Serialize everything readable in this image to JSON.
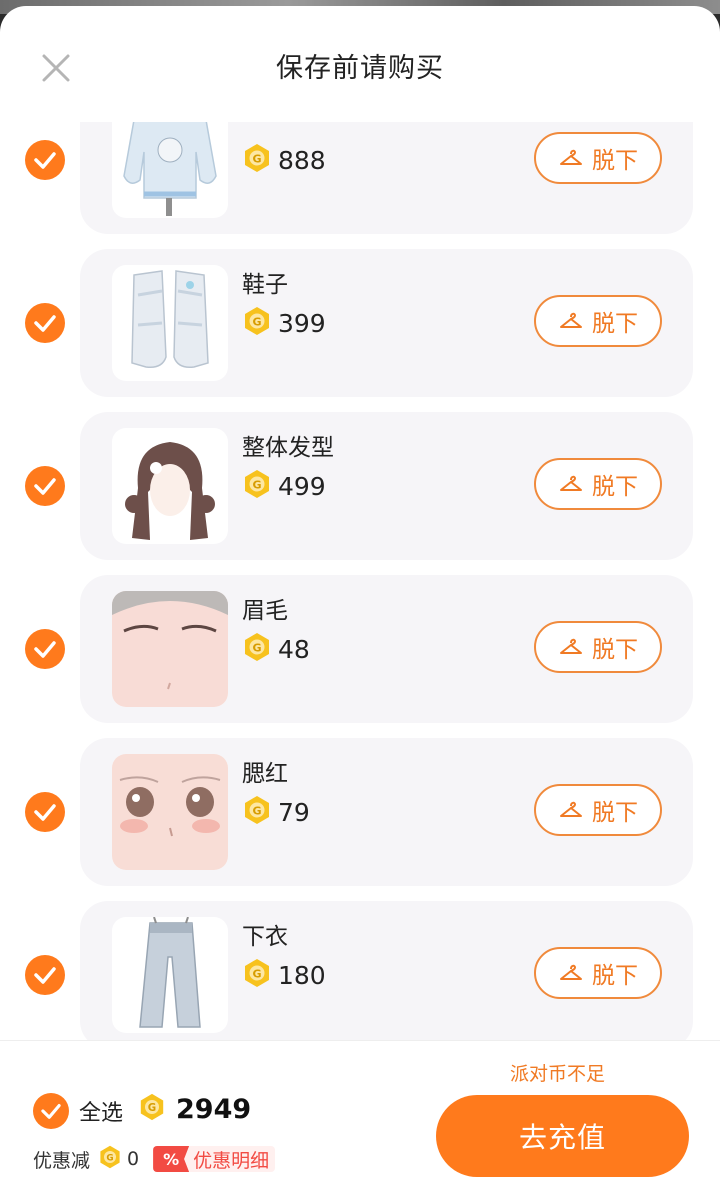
{
  "dialog": {
    "title": "保存前请购买"
  },
  "items": [
    {
      "name": "",
      "price": "888",
      "remove_label": "脱下",
      "thumb": "hoodie"
    },
    {
      "name": "鞋子",
      "price": "399",
      "remove_label": "脱下",
      "thumb": "shoes"
    },
    {
      "name": "整体发型",
      "price": "499",
      "remove_label": "脱下",
      "thumb": "hair"
    },
    {
      "name": "眉毛",
      "price": "48",
      "remove_label": "脱下",
      "thumb": "eyebrows"
    },
    {
      "name": "腮红",
      "price": "79",
      "remove_label": "脱下",
      "thumb": "blush"
    },
    {
      "name": "下衣",
      "price": "180",
      "remove_label": "脱下",
      "thumb": "pants"
    }
  ],
  "footer": {
    "select_all_label": "全选",
    "total": "2949",
    "discount_label": "优惠减",
    "discount_value": "0",
    "detail_icon": "%",
    "detail_label": "优惠明细",
    "insufficient_text": "派对币不足",
    "recharge_label": "去充值"
  },
  "colors": {
    "accent": "#ff7a1c",
    "coin": "#f7c21e",
    "card": "#f6f5f8",
    "red": "#f24b43"
  },
  "icons": {
    "close": "close-icon",
    "check": "check-icon",
    "coin": "coin-icon",
    "hanger": "hanger-icon"
  }
}
